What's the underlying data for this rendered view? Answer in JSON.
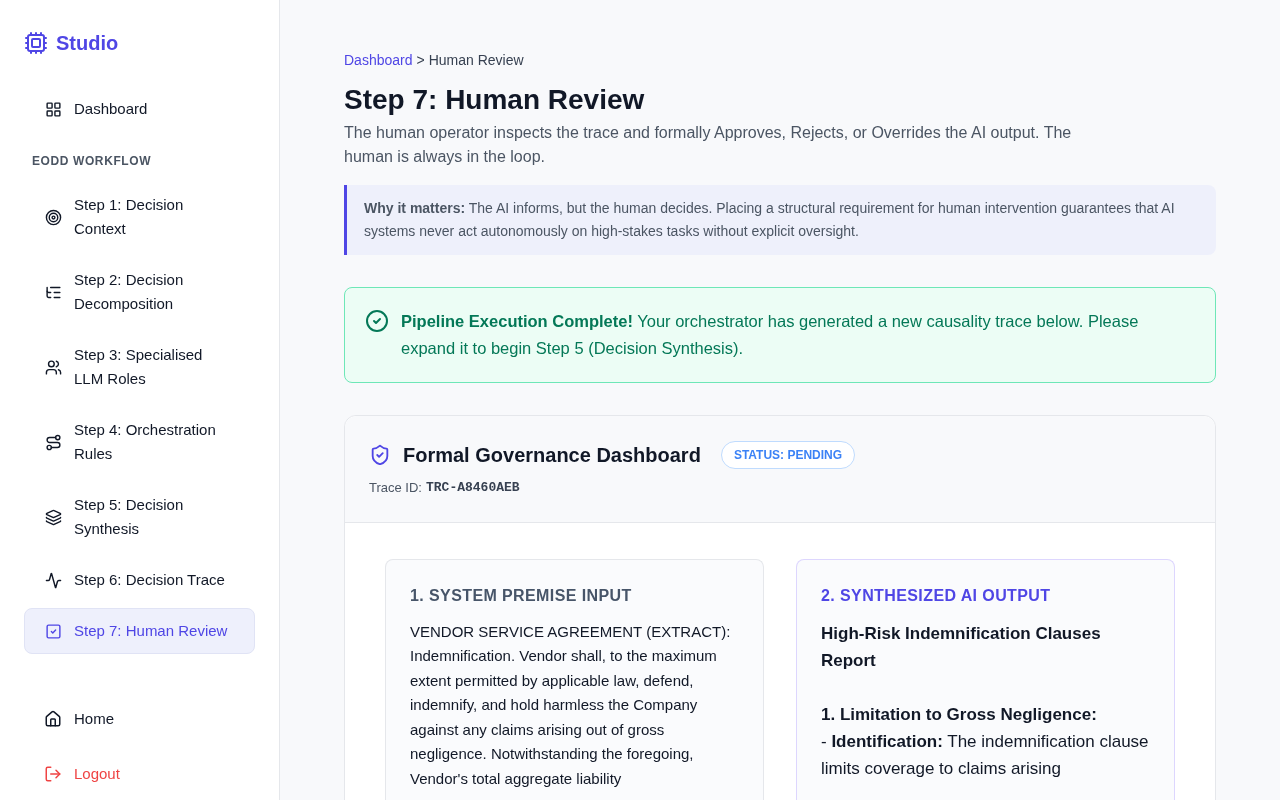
{
  "brand": "Studio",
  "sidebar": {
    "top_item": {
      "label": "Dashboard",
      "selected": false
    },
    "section_label": "EODD WORKFLOW",
    "items": [
      {
        "label": "Step 1: Decision Context",
        "selected": false
      },
      {
        "label": "Step 2: Decision Decomposition",
        "selected": false
      },
      {
        "label": "Step 3: Specialised LLM Roles",
        "selected": false
      },
      {
        "label": "Step 4: Orchestration Rules",
        "selected": false
      },
      {
        "label": "Step 5: Decision Synthesis",
        "selected": false
      },
      {
        "label": "Step 6: Decision Trace",
        "selected": false
      },
      {
        "label": "Step 7: Human Review",
        "selected": true
      }
    ],
    "footer_items": [
      {
        "label": "Home",
        "kind": "nav"
      },
      {
        "label": "Logout",
        "kind": "danger"
      }
    ]
  },
  "breadcrumb": {
    "link": "Dashboard",
    "separator": ">",
    "current": "Human Review"
  },
  "title": "Step 7: Human Review",
  "description": "The human operator inspects the trace and formally Approves, Rejects, or Overrides the AI output. The human is always in the loop.",
  "callout": "**Why it matters:** The AI informs, but the human decides. Placing a structural requirement for human intervention guarantees that AI systems never act autonomously on high-stakes tasks without explicit oversight.",
  "success_alert": "**Pipeline Execution Complete!** Your orchestrator has generated a new causality trace below. Please expand it to begin Step 5 (Decision Synthesis).",
  "dashboard": {
    "title": "Formal Governance Dashboard",
    "status": "STATUS: PENDING",
    "trace_label": "Trace ID:",
    "trace_id": "TRC-A8460AEB",
    "panels": [
      {
        "kind": "input",
        "heading": "1. SYSTEM PREMISE INPUT",
        "lines": [
          "VENDOR SERVICE AGREEMENT (EXTRACT): Indemnification. Vendor shall, to the maximum extent permitted by applicable law, defend, indemnify, and hold harmless the Company against any claims arising out of gross negligence. Notwithstanding the foregoing, Vendor's total aggregate liability"
        ]
      },
      {
        "kind": "output",
        "heading": "2. SYNTHESIZED AI OUTPUT",
        "title": "High-Risk Indemnification Clauses Report",
        "lines": [
          "**1. Limitation to Gross Negligence:**",
          "- **Identification:** The indemnification clause limits coverage to claims arising"
        ]
      }
    ]
  }
}
